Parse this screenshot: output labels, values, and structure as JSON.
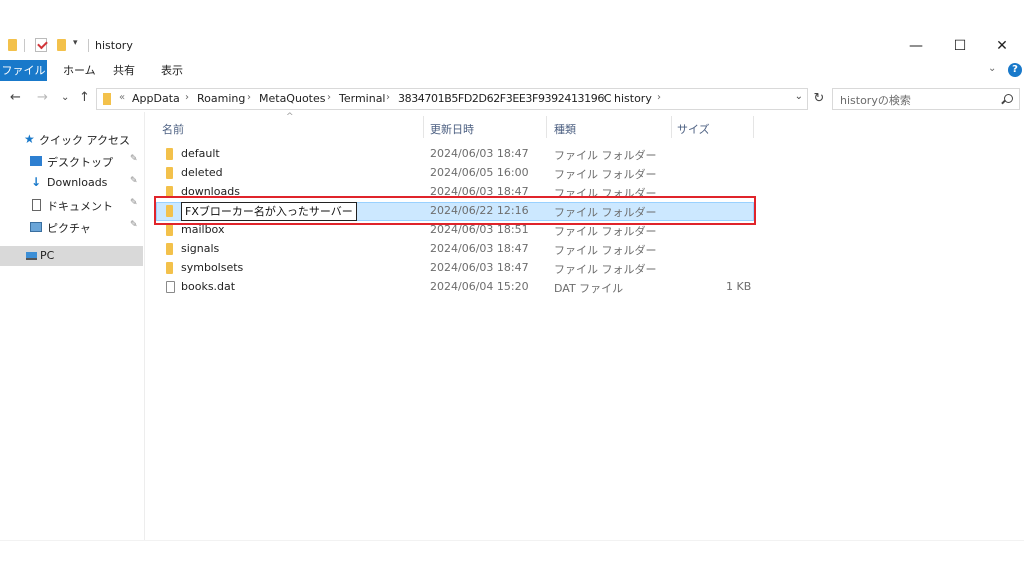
{
  "window": {
    "title": "history",
    "minimize": "—",
    "maximize": "☐",
    "close": "✕",
    "qa_arrow": "▾"
  },
  "ribbon": {
    "tabs": [
      "ファイル",
      "ホーム",
      "共有",
      "表示"
    ],
    "expand_glyph": "⌄",
    "help": "?"
  },
  "nav": {
    "back": "←",
    "forward": "→",
    "recent": "⌄",
    "up": "↑",
    "lead": "«",
    "breadcrumb": [
      "AppData",
      "Roaming",
      "MetaQuotes",
      "Terminal",
      "3834701B5FD2D62F3EE3F9392413196C",
      "history"
    ],
    "separator": "›",
    "dropdown": "⌄",
    "refresh": "↻",
    "search_placeholder": "historyの検索"
  },
  "sidebar": {
    "items": [
      {
        "label": "クイック アクセス",
        "icon": "star-icon",
        "pinned": false
      },
      {
        "label": "デスクトップ",
        "icon": "desktop-icon",
        "pinned": true
      },
      {
        "label": "Downloads",
        "icon": "download-arrow-icon",
        "pinned": true
      },
      {
        "label": "ドキュメント",
        "icon": "document-icon",
        "pinned": true
      },
      {
        "label": "ピクチャ",
        "icon": "pictures-icon",
        "pinned": true
      },
      {
        "label": "PC",
        "icon": "pc-icon",
        "pinned": false
      }
    ],
    "pin_glyph": "📌"
  },
  "columns": {
    "name": "名前",
    "modified": "更新日時",
    "type": "種類",
    "size": "サイズ",
    "sort_caret": "^"
  },
  "files": [
    {
      "name": "default",
      "date": "2024/06/03 18:47",
      "type": "ファイル フォルダー",
      "size": ""
    },
    {
      "name": "deleted",
      "date": "2024/06/05 16:00",
      "type": "ファイル フォルダー",
      "size": ""
    },
    {
      "name": "downloads",
      "date": "2024/06/03 18:47",
      "type": "ファイル フォルダー",
      "size": ""
    },
    {
      "name": "FXブローカー名が入ったサーバー",
      "date": "2024/06/22 12:16",
      "type": "ファイル フォルダー",
      "size": ""
    },
    {
      "name": "mailbox",
      "date": "2024/06/03 18:51",
      "type": "ファイル フォルダー",
      "size": ""
    },
    {
      "name": "signals",
      "date": "2024/06/03 18:47",
      "type": "ファイル フォルダー",
      "size": ""
    },
    {
      "name": "symbolsets",
      "date": "2024/06/03 18:47",
      "type": "ファイル フォルダー",
      "size": ""
    },
    {
      "name": "books.dat",
      "date": "2024/06/04 15:20",
      "type": "DAT ファイル",
      "size": "1 KB"
    }
  ],
  "selected_row": 3,
  "colors": {
    "accent": "#1979ca",
    "selection_fill": "#cce8ff",
    "highlight_border": "#e0242b",
    "folder": "#f3c14b"
  }
}
